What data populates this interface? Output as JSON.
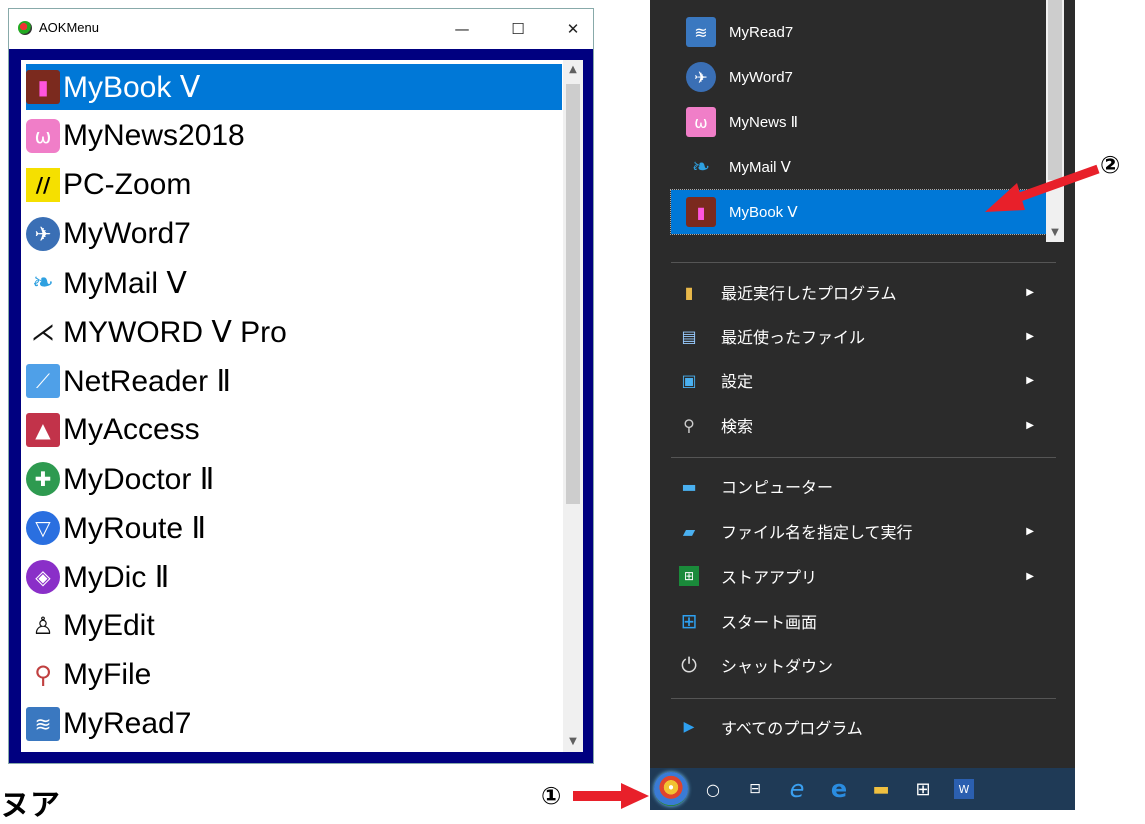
{
  "window": {
    "title": "AOKMenu",
    "minimize_glyph": "—",
    "maximize_glyph": "☐",
    "close_glyph": "✕",
    "items": [
      {
        "label": "MyBook Ⅴ",
        "icon": "book-icon",
        "selected": true
      },
      {
        "label": "MyNews2018",
        "icon": "rabbit-icon"
      },
      {
        "label": "PC-Zoom",
        "icon": "zoom-logo-icon"
      },
      {
        "label": "MyWord7",
        "icon": "orca-icon"
      },
      {
        "label": "MyMail Ⅴ",
        "icon": "bird-icon"
      },
      {
        "label": "MYWORD Ⅴ  Pro",
        "icon": "whale-icon"
      },
      {
        "label": "NetReader Ⅱ",
        "icon": "chart-icon"
      },
      {
        "label": "MyAccess",
        "icon": "triangle-logo-icon"
      },
      {
        "label": "MyDoctor Ⅱ",
        "icon": "medical-cross-icon"
      },
      {
        "label": "MyRoute Ⅱ",
        "icon": "shield-icon"
      },
      {
        "label": "MyDic Ⅱ",
        "icon": "dictionary-icon"
      },
      {
        "label": "MyEdit",
        "icon": "penguin-icon"
      },
      {
        "label": "MyFile",
        "icon": "magnifier-icon"
      },
      {
        "label": "MyRead7",
        "icon": "wave-icon"
      }
    ]
  },
  "cut_text": "ヌア",
  "start_menu": {
    "programs": [
      {
        "label": "MyRead7",
        "icon": "wave-icon"
      },
      {
        "label": "MyWord7",
        "icon": "orca-icon"
      },
      {
        "label": "MyNews Ⅱ",
        "icon": "rabbit-icon"
      },
      {
        "label": "MyMail Ⅴ",
        "icon": "bird-icon"
      },
      {
        "label": "MyBook Ⅴ",
        "icon": "book-icon",
        "selected": true
      }
    ],
    "menu_group1": [
      {
        "label": "最近実行したプログラム",
        "icon": "folder-icon",
        "submenu": true
      },
      {
        "label": "最近使ったファイル",
        "icon": "recent-files-icon",
        "submenu": true
      },
      {
        "label": "設定",
        "icon": "control-panel-icon",
        "submenu": true
      },
      {
        "label": "検索",
        "icon": "search-icon",
        "submenu": true
      }
    ],
    "menu_group2": [
      {
        "label": "コンピューター",
        "icon": "computer-icon",
        "submenu": false
      },
      {
        "label": "ファイル名を指定して実行",
        "icon": "run-icon",
        "submenu": true
      },
      {
        "label": "ストアアプリ",
        "icon": "store-icon",
        "submenu": true
      },
      {
        "label": "スタート画面",
        "icon": "windows-icon",
        "submenu": false
      },
      {
        "label": "シャットダウン",
        "icon": "power-icon",
        "submenu": false
      }
    ],
    "all_programs": "すべてのプログラム"
  },
  "annotations": {
    "one": "①",
    "two": "②"
  },
  "colors": {
    "selection": "#0078d7",
    "frame": "#000080",
    "start_bg": "#2b2b2b",
    "arrow": "#e8202a"
  }
}
